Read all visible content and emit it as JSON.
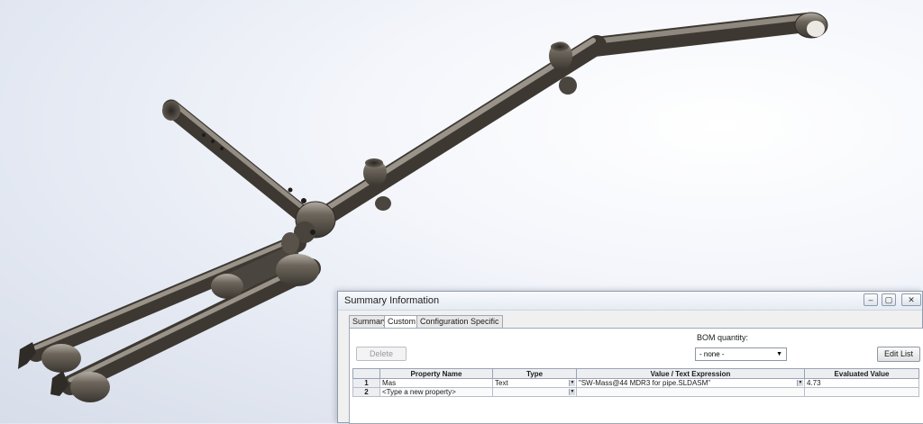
{
  "dialog": {
    "title": "Summary Information",
    "window_buttons": {
      "minimize": "–",
      "maximize": "▢",
      "close": "✕"
    },
    "tabs": [
      {
        "label": "Summary",
        "active": false
      },
      {
        "label": "Custom",
        "active": true
      },
      {
        "label": "Configuration Specific",
        "active": false
      }
    ],
    "delete_label": "Delete",
    "bom_label": "BOM quantity:",
    "bom_value": "- none -",
    "edit_list_label": "Edit List",
    "table": {
      "headers": [
        "",
        "Property Name",
        "Type",
        "Value / Text Expression",
        "Evaluated Value"
      ],
      "rows": [
        {
          "num": "1",
          "name": "Mas",
          "type": "Text",
          "value": "\"SW-Mass@44 MDR3 for pipe.SLDASM\"",
          "evaluated": "4.73"
        },
        {
          "num": "2",
          "name": "<Type a new property>",
          "type": "",
          "value": "",
          "evaluated": ""
        }
      ]
    }
  },
  "colors": {
    "pipe": "#58524a",
    "pipe_highlight": "#b3aca2",
    "background": "#e3e8f2",
    "dialog_bg": "#f0f0f0"
  }
}
